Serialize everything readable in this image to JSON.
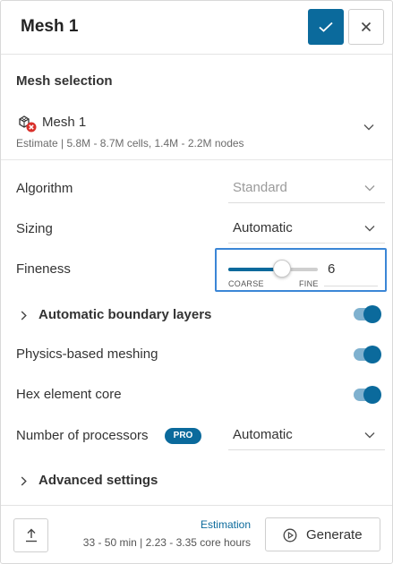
{
  "header": {
    "title": "Mesh 1"
  },
  "mesh_selection": {
    "section_title": "Mesh selection",
    "mesh_name": "Mesh 1",
    "estimate": "Estimate | 5.8M - 8.7M cells, 1.4M - 2.2M nodes"
  },
  "settings": {
    "algorithm": {
      "label": "Algorithm",
      "value": "Standard"
    },
    "sizing": {
      "label": "Sizing",
      "value": "Automatic"
    },
    "fineness": {
      "label": "Fineness",
      "value": "6",
      "level": 0.6,
      "min_label": "COARSE",
      "max_label": "FINE"
    },
    "boundary_layers": {
      "label": "Automatic boundary layers",
      "enabled": true
    },
    "physics_based": {
      "label": "Physics-based meshing",
      "enabled": true
    },
    "hex_core": {
      "label": "Hex element core",
      "enabled": true
    },
    "processors": {
      "label": "Number of processors",
      "badge": "PRO",
      "value": "Automatic"
    },
    "advanced": {
      "label": "Advanced settings"
    }
  },
  "footer": {
    "estimation_title": "Estimation",
    "estimation_detail": "33 - 50 min | 2.23 - 3.35 core hours",
    "generate_label": "Generate"
  },
  "colors": {
    "accent": "#0b6a9c",
    "focus_border": "#3b86d6",
    "error": "#d9302b"
  },
  "icons": [
    "check-icon",
    "close-icon",
    "mesh-error-icon",
    "chevron-down-icon",
    "chevron-right-icon",
    "upload-icon",
    "play-circle-icon"
  ]
}
